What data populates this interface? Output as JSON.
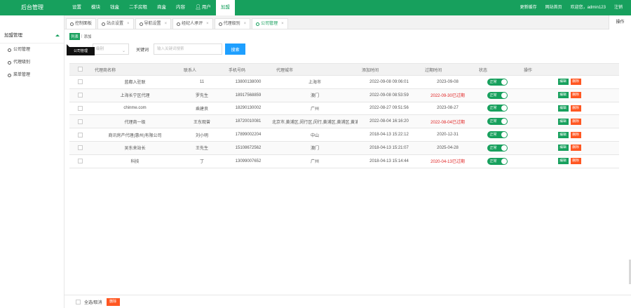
{
  "app": {
    "title": "后台管理"
  },
  "topnav": {
    "items": [
      {
        "label": "设置"
      },
      {
        "label": "模块"
      },
      {
        "label": "钱盒"
      },
      {
        "label": "二手房租"
      },
      {
        "label": "商盒"
      },
      {
        "label": "内容"
      },
      {
        "label": "用户"
      },
      {
        "label": "加盟"
      }
    ],
    "active_index": 7,
    "right": {
      "clear_cache": "更新缓存",
      "site_home": "网站首页",
      "welcome": "欢迎您，admin123",
      "logout": "注销"
    }
  },
  "sidebar": {
    "group": "加盟管理",
    "items": [
      {
        "label": "公司管理"
      },
      {
        "label": "代理级别"
      },
      {
        "label": "菜单管理"
      }
    ]
  },
  "tabs": {
    "items": [
      {
        "label": "控制面板",
        "closable": false
      },
      {
        "label": "站点设置",
        "closable": true
      },
      {
        "label": "导航设置",
        "closable": true
      },
      {
        "label": "经纪人承评",
        "closable": true
      },
      {
        "label": "代理级别",
        "closable": true
      },
      {
        "label": "公司管理",
        "closable": true
      }
    ],
    "active_index": 5,
    "close_glyph": "×",
    "ops_label": "操作"
  },
  "breadcrumb": {
    "current": "列表",
    "next": "添加"
  },
  "tooltip": "公司管理",
  "search": {
    "select_value": "级别",
    "keyword_label": "关键词",
    "keyword_placeholder": "输入关键词搜索",
    "button": "搜索"
  },
  "table": {
    "headers": [
      "",
      "代理商名称",
      "联系人",
      "手机号码",
      "代理城市",
      "添加时间",
      "过期时间",
      "状态",
      "操作"
    ],
    "rows": [
      {
        "name": "蓝都入驻联",
        "contact": "11",
        "phone": "13800138000",
        "city": "上海市",
        "added": "2022-09-08 09:06:01",
        "expire": "2023-09-08",
        "expire_red": false,
        "status": "正常"
      },
      {
        "name": "上海长宁区代理",
        "contact": "罗先生",
        "phone": "18917568859",
        "city": "澳门",
        "added": "2022-09-08 08:53:59",
        "expire": "2022-09-30已过期",
        "expire_red": true,
        "status": "正常"
      },
      {
        "name": "chinme.com",
        "contact": "乘建良",
        "phone": "18290130002",
        "city": "广州",
        "added": "2022-08-27 09:51:56",
        "expire": "2023-08-27",
        "expire_red": false,
        "status": "正常"
      },
      {
        "name": "代理商一级",
        "contact": "王东观曾",
        "phone": "18720010081",
        "city": "北京市,黄浦区,闵行区,闵行,黄浦区,黄浦区,黄浦区,黄浦区",
        "added": "2022-08-04 16:16:20",
        "expire": "2022-08-04已过期",
        "expire_red": true,
        "status": "正常"
      },
      {
        "name": "商讯房产代理(惠州)有限公司",
        "contact": "刘小明",
        "phone": "17899002204",
        "city": "中山",
        "added": "2018-04-13 15:22:12",
        "expire": "2020-12-31",
        "expire_red": false,
        "status": "正常"
      },
      {
        "name": "吴东来站长",
        "contact": "王先生",
        "phone": "15108672562",
        "city": "澳门",
        "added": "2018-04-13 15:21:07",
        "expire": "2025-04-28",
        "expire_red": false,
        "status": "正常"
      },
      {
        "name": "科技",
        "contact": "丁",
        "phone": "13099007652",
        "city": "广州",
        "added": "2018-04-13 15:14:44",
        "expire": "2020-04-13已过期",
        "expire_red": true,
        "status": "正常"
      }
    ],
    "edit_label": "编辑",
    "delete_label": "删除"
  },
  "footer": {
    "select_all": "全选/取消",
    "delete": "删除"
  },
  "colors": {
    "brand": "#17a05d",
    "primary_button": "#1e9fff",
    "danger": "#ff5722",
    "expired": "#e02222"
  }
}
